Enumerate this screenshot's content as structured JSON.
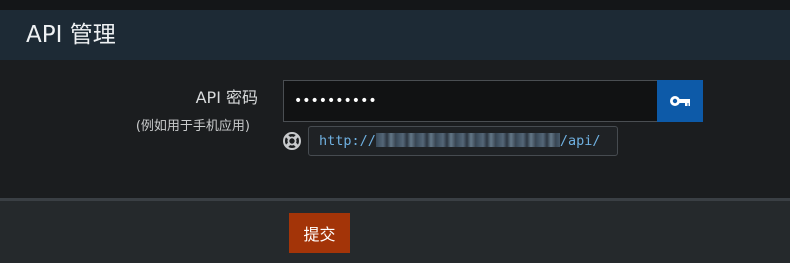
{
  "header": {
    "title": "API 管理"
  },
  "form": {
    "api_password": {
      "label": "API 密码",
      "sublabel": "(例如用于手机应用)",
      "value": "••••••••••"
    },
    "key_button_icon": "key-icon",
    "help_icon": "lifebuoy-icon",
    "api_url": {
      "prefix": "http://",
      "suffix": "/api/"
    }
  },
  "footer": {
    "submit_label": "提交"
  },
  "colors": {
    "header_bg": "#1d2a35",
    "page_bg": "#1b1d1f",
    "accent_blue": "#0d5aa8",
    "submit_red": "#a33408",
    "url_text": "#6fb0e0"
  }
}
